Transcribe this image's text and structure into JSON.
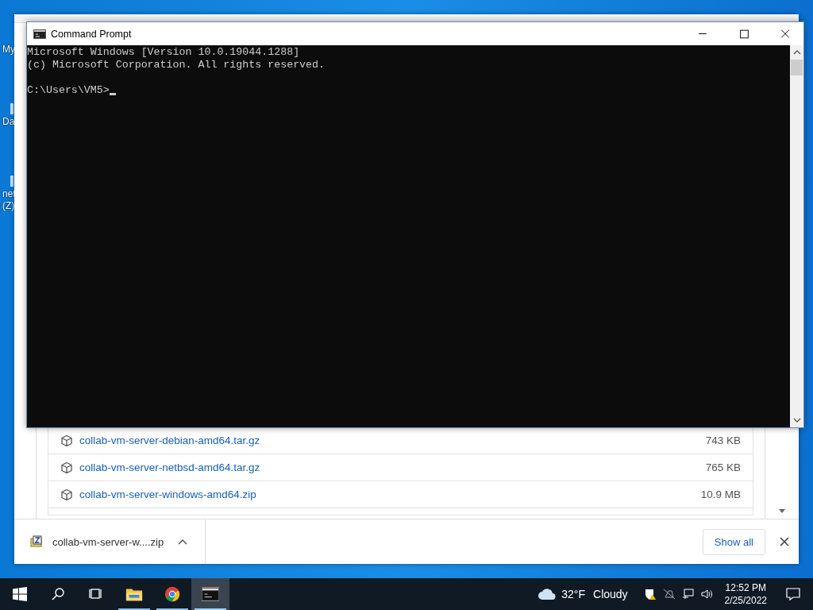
{
  "desktop_icons": [
    {
      "lines": [
        "My"
      ]
    },
    {
      "lines": [
        "Da"
      ]
    },
    {
      "lines": [
        "net",
        "(Z)"
      ]
    }
  ],
  "browser": {
    "files": [
      {
        "name": "collab-vm-server-debian-amd64.tar.gz",
        "size": "743 KB"
      },
      {
        "name": "collab-vm-server-netbsd-amd64.tar.gz",
        "size": "765 KB"
      },
      {
        "name": "collab-vm-server-windows-amd64.zip",
        "size": "10.9 MB"
      }
    ],
    "download": {
      "filename": "collab-vm-server-w....zip"
    },
    "show_all": "Show all"
  },
  "console": {
    "title": "Command Prompt",
    "lines": [
      "Microsoft Windows [Version 10.0.19044.1288]",
      "(c) Microsoft Corporation. All rights reserved."
    ],
    "prompt": "C:\\Users\\VM5>"
  },
  "taskbar": {
    "apps": [
      {
        "kind": "folder",
        "selected": false
      },
      {
        "kind": "chrome",
        "selected": false
      },
      {
        "kind": "cmd",
        "selected": true
      }
    ],
    "weather": {
      "temp": "32°F",
      "condition": "Cloudy"
    },
    "time": "12:52 PM",
    "date": "2/25/2022"
  }
}
